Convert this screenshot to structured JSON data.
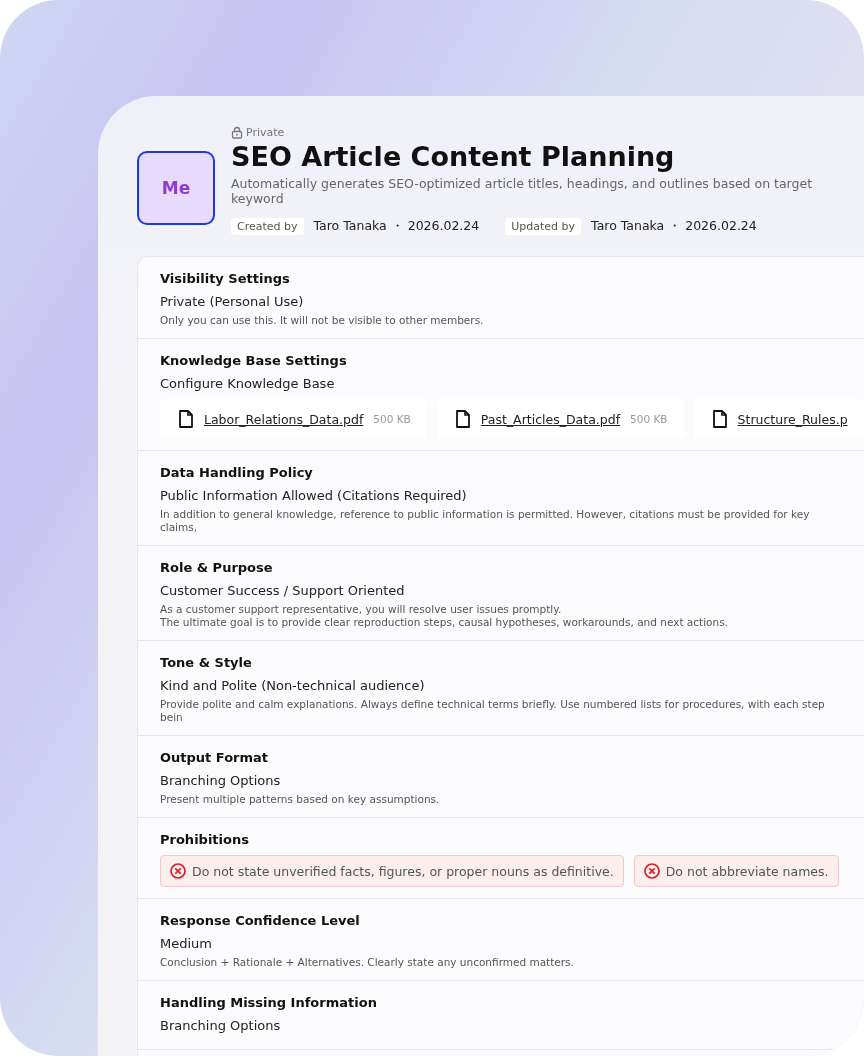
{
  "header": {
    "visibility_label": "Private",
    "avatar": "Me",
    "title": "SEO Article Content Planning",
    "description": "Automatically generates SEO-optimized article titles, headings, and outlines based on target keyword",
    "meta": [
      {
        "label": "Created by",
        "value": "Taro Tanaka ・ 2026.02.24"
      },
      {
        "label": "Updated by",
        "value": "Taro Tanaka ・ 2026.02.24"
      }
    ]
  },
  "sections": [
    {
      "kind": "text",
      "title": "Visibility Settings",
      "value": "Private (Personal Use)",
      "description": [
        "Only you can use this. It will not be visible to other members."
      ]
    },
    {
      "kind": "files",
      "title": "Knowledge Base Settings",
      "value": "Configure Knowledge Base",
      "files": [
        {
          "name": "Labor_Relations_Data.pdf",
          "size": "500 KB"
        },
        {
          "name": "Past_Articles_Data.pdf",
          "size": "500 KB"
        },
        {
          "name": "Structure_Rules.p"
        }
      ]
    },
    {
      "kind": "text",
      "title": "Data Handling Policy",
      "value": "Public Information Allowed (Citations Required)",
      "description": [
        "In addition to general knowledge, reference to public information is permitted. However, citations must be provided for key claims,"
      ]
    },
    {
      "kind": "text",
      "title": "Role & Purpose",
      "value": "Customer Success / Support Oriented",
      "description": [
        "As a customer support representative, you will resolve user issues promptly.",
        "The ultimate goal is to provide clear reproduction steps, causal hypotheses, workarounds, and next actions."
      ]
    },
    {
      "kind": "text",
      "title": "Tone & Style",
      "value": "Kind and Polite (Non-technical audience)",
      "description": [
        "Provide polite and calm explanations. Always define technical terms briefly. Use numbered lists for procedures, with each step bein"
      ]
    },
    {
      "kind": "text",
      "title": "Output Format",
      "value": "Branching Options",
      "description": [
        "Present multiple patterns based on key assumptions."
      ]
    },
    {
      "kind": "prohibitions",
      "title": "Prohibitions",
      "items": [
        "Do not state unverified facts, figures, or proper nouns as definitive.",
        "Do not abbreviate names."
      ]
    },
    {
      "kind": "text",
      "title": "Response Confidence Level",
      "value": "Medium",
      "description": [
        "Conclusion + Rationale + Alternatives. Clearly state any unconfirmed matters."
      ]
    },
    {
      "kind": "text",
      "title": "Handling Missing Information",
      "value": "Branching Options"
    }
  ]
}
